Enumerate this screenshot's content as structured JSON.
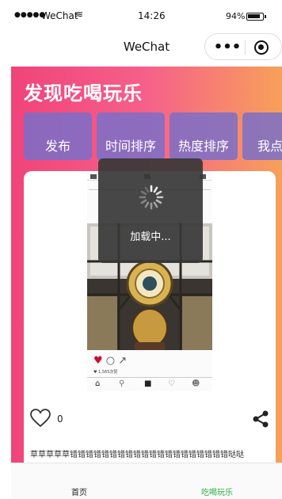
{
  "status_bar": {
    "signal": "●●●●●",
    "carrier": "WeChat",
    "wifi_icon": "wifi-icon",
    "time": "14:26",
    "battery": "94%"
  },
  "nav": {
    "title": "WeChat",
    "more_icon": "•••",
    "close_icon": "target-icon"
  },
  "page": {
    "title": "发现吃喝玩乐",
    "gradient": [
      "#f0447a",
      "#f7a05a"
    ],
    "tab_color": "#7a6ec8"
  },
  "tabs": [
    {
      "label": "发布"
    },
    {
      "label": "时间排序"
    },
    {
      "label": "热度排序"
    },
    {
      "label": "我点赞"
    }
  ],
  "post": {
    "image_icon": "phone-screenshot-image",
    "photo_likes": "♥ 1,565次赞",
    "like_count": "0",
    "text": "草草草草草错错错错错错错错错错错错错错错错错错错错哒哒"
  },
  "toast": {
    "text": "加载中..."
  },
  "tabbar": {
    "home": "首页",
    "fun": "吃喝玩乐",
    "active_color": "#2aae3e"
  }
}
